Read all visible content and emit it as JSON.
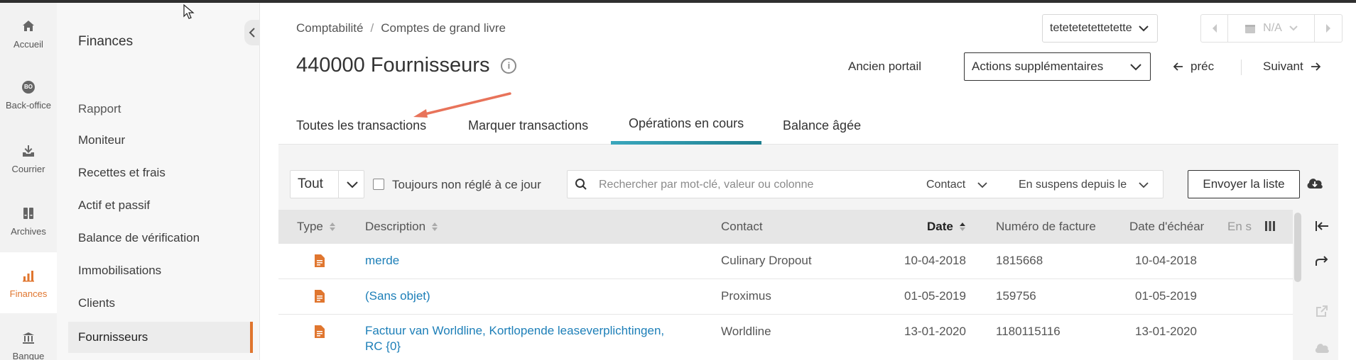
{
  "rail": [
    {
      "label": "Accueil",
      "icon": "home-icon"
    },
    {
      "label": "Back-office",
      "icon": "bo-badge-icon",
      "badge": "BO"
    },
    {
      "label": "Courrier",
      "icon": "inbox-download-icon"
    },
    {
      "label": "Archives",
      "icon": "archive-icon"
    },
    {
      "label": "Finances",
      "icon": "bar-chart-icon",
      "active": true
    },
    {
      "label": "Banque",
      "icon": "bank-icon"
    }
  ],
  "sidebar": {
    "title": "Finances",
    "section": "Rapport",
    "items": [
      {
        "label": "Moniteur"
      },
      {
        "label": "Recettes et frais"
      },
      {
        "label": "Actif et passif"
      },
      {
        "label": "Balance de vérification"
      },
      {
        "label": "Immobilisations"
      },
      {
        "label": "Clients"
      },
      {
        "label": "Fournisseurs",
        "active": true
      }
    ]
  },
  "breadcrumb": {
    "first": "Comptabilité",
    "sep": "/",
    "second": "Comptes de grand livre"
  },
  "page": {
    "title": "440000 Fournisseurs"
  },
  "header": {
    "org_select": "tetetetetettetette",
    "period": "N/A",
    "old_portal": "Ancien portail",
    "more_actions": "Actions supplémentaires",
    "prev": "préc",
    "next": "Suivant"
  },
  "tabs": [
    {
      "label": "Toutes les transactions"
    },
    {
      "label": "Marquer transactions"
    },
    {
      "label": "Opérations en cours",
      "active": true
    },
    {
      "label": "Balance âgée"
    }
  ],
  "filters": {
    "scope": "Tout",
    "unpaid_label": "Toujours non réglé à ce jour",
    "search_placeholder": "Rechercher par mot-clé, valeur ou colonne",
    "contact_dd": "Contact",
    "pending_dd": "En suspens depuis le",
    "send_button": "Envoyer la liste"
  },
  "table": {
    "columns": {
      "type": "Type",
      "description": "Description",
      "contact": "Contact",
      "date": "Date",
      "invoice": "Numéro de facture",
      "due": "Date d'échéan",
      "pending": "En s"
    },
    "rows": [
      {
        "description": "merde",
        "description2": "",
        "contact": "Culinary Dropout",
        "date": "10-04-2018",
        "invoice": "1815668",
        "due": "10-04-2018"
      },
      {
        "description": "(Sans objet)",
        "description2": "",
        "contact": "Proximus",
        "date": "01-05-2019",
        "invoice": "159756",
        "due": "01-05-2019"
      },
      {
        "description": "Factuur van Worldline, Kortlopende leaseverplichtingen,",
        "description2": "RC {0}",
        "contact": "Worldline",
        "date": "13-01-2020",
        "invoice": "1180115116",
        "due": "13-01-2020"
      }
    ]
  },
  "colors": {
    "accent": "#e0762f",
    "link": "#1d7fb8",
    "tab_active": "#2a95a8"
  }
}
